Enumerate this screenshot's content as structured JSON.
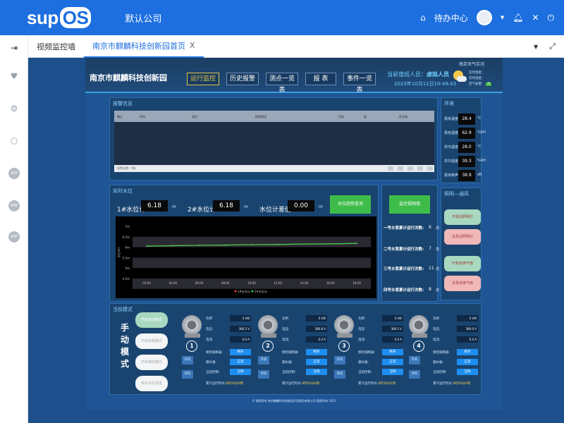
{
  "app": {
    "logo_main": "sup",
    "logo_badge": "OS",
    "company": "默认公司"
  },
  "topbar": {
    "todo_label": "待办中心"
  },
  "tabs": [
    {
      "label": "视频监控墙"
    },
    {
      "label": "南京市麒麟科技创新园首页"
    }
  ],
  "tab_close": "X",
  "sidebar": {
    "app_badge": "APP"
  },
  "header": {
    "title": "南京市麒麟科技创新园",
    "buttons": [
      "运行监控",
      "历史报警",
      "测点一览表",
      "报 表",
      "事件一览表"
    ],
    "user_label": "当前值班人员：",
    "user_name": "虚拟人员",
    "datetime": "2023年10月11日10:49:43"
  },
  "weather": {
    "title": "南京天气实况",
    "rows": [
      "实时温度：",
      "实时湿度：",
      "空气质量："
    ],
    "quality_badge": "优"
  },
  "alarm": {
    "title": "报警信息",
    "columns": [
      "确认",
      "时间",
      "测点",
      "报警描述",
      "状态",
      "值",
      "优先级"
    ],
    "footer_text": "报警总数：0条"
  },
  "environment": {
    "title": "环境",
    "rows": [
      {
        "label": "泵房温度：",
        "value": "28.4",
        "unit": "℃"
      },
      {
        "label": "泵房湿度：",
        "value": "62.9",
        "unit": "%RH"
      },
      {
        "label": "井内温度：",
        "value": "28.0",
        "unit": "℃"
      },
      {
        "label": "井内湿度：",
        "value": "39.3",
        "unit": "%RH"
      },
      {
        "label": "泵房噪声：",
        "value": "38.9",
        "unit": "dB"
      }
    ]
  },
  "ventilation": {
    "title": "照明—通风",
    "buttons": [
      {
        "label": "开泵站照明灯",
        "color": "#a8d8c0"
      },
      {
        "label": "关泵站照明灯",
        "color": "#f0b8b8"
      },
      {
        "label": "开泵房排气扇",
        "color": "#a8d8c0"
      },
      {
        "label": "关泵房排气扇",
        "color": "#f0b8b8"
      }
    ]
  },
  "water_level": {
    "title": "实时水位",
    "items": [
      {
        "label": "1#水位计:",
        "value": "6.18",
        "unit": "m"
      },
      {
        "label": "2#水位计:",
        "value": "6.18",
        "unit": "m"
      },
      {
        "label": "水位计差值:",
        "value": "0.00",
        "unit": "m"
      }
    ],
    "trend_button": "水位趋势查询",
    "video_button": "监控视频墙"
  },
  "pump_counts": {
    "rows": [
      {
        "label": "一号水泵累计运行次数:",
        "value": "6",
        "unit": "次"
      },
      {
        "label": "二号水泵累计运行次数:",
        "value": "7",
        "unit": "次"
      },
      {
        "label": "三号水泵累计运行次数:",
        "value": "11",
        "unit": "次"
      },
      {
        "label": "四号水泵累计运行次数:",
        "value": "8",
        "unit": "次"
      }
    ]
  },
  "mode": {
    "panel_title": "当前模式",
    "title": "手动模式",
    "buttons": [
      {
        "label": "开启自动模式",
        "active": true
      },
      {
        "label": "开启远程模式",
        "active": false
      },
      {
        "label": "开启维修模式",
        "active": false
      },
      {
        "label": "特定水位设置",
        "active": false
      }
    ]
  },
  "pumps": [
    {
      "num": "1",
      "power": "0 kW",
      "voltage": "380.2 V",
      "current": "0.0 A",
      "fault": "断开",
      "leak": "正常",
      "control": "当地",
      "time": "0时20分0秒"
    },
    {
      "num": "2",
      "power": "0 kW",
      "voltage": "380.8 V",
      "current": "0.0 A",
      "fault": "断开",
      "leak": "正常",
      "control": "当地",
      "time": "0时20分0秒"
    },
    {
      "num": "3",
      "power": "0 kW",
      "voltage": "380.2 V",
      "current": "0.0 A",
      "fault": "断开",
      "leak": "正常",
      "control": "当地",
      "time": "0时30分1秒"
    },
    {
      "num": "4",
      "power": "0 kW",
      "voltage": "380.0 V",
      "current": "0.0 A",
      "fault": "断开",
      "leak": "正常",
      "control": "当地",
      "time": "0时20分0秒"
    }
  ],
  "pump_labels": {
    "power": "功率:",
    "voltage": "电压:",
    "current": "电流:",
    "fault": "保险熔断器:",
    "leak": "漏水报:",
    "control": "当前控制:",
    "time": "累计运行时长:",
    "start": "开机",
    "stop": "停机"
  },
  "footer": "© 版权所有 南京麒麟科技创新园开发建设有限公司 版权所有 2023",
  "chart_data": {
    "type": "line",
    "title": "",
    "xlabel": "",
    "ylabel": "水位(m)",
    "x": [
      "02:00",
      "04:00",
      "06:00",
      "08:00",
      "10:00",
      "12:00",
      "14:00",
      "16:00",
      "18:00"
    ],
    "yticks": [
      "7m",
      "6.5m",
      "6m",
      "5.5m",
      "5m",
      "4.5m"
    ],
    "ylim": [
      4.5,
      7
    ],
    "legend_placement": "bottom",
    "series": [
      {
        "name": "1#水位计",
        "color": "#e84a3a",
        "values": [
          6.05,
          6.07,
          6.09,
          6.1,
          6.12,
          6.13,
          6.15,
          6.16,
          6.18
        ]
      },
      {
        "name": "2#水位计",
        "color": "#39d04a",
        "values": [
          6.05,
          6.07,
          6.09,
          6.1,
          6.12,
          6.13,
          6.15,
          6.16,
          6.18
        ]
      }
    ]
  }
}
